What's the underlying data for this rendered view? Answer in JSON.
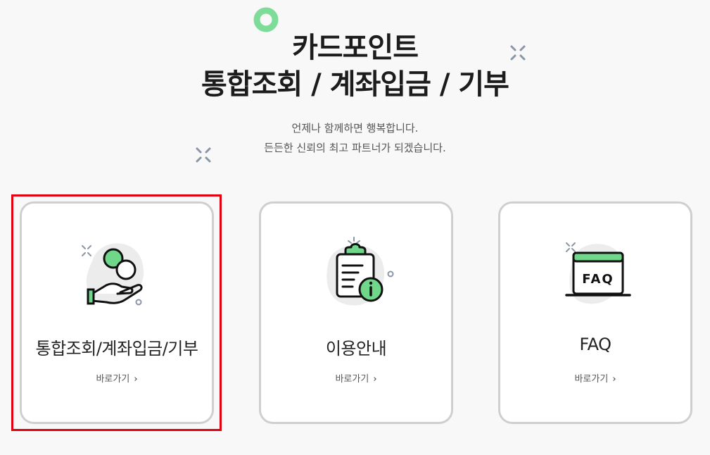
{
  "hero": {
    "title_line1": "카드포인트",
    "title_line2": "통합조회 / 계좌입금 / 기부",
    "subtitle_line1": "언제나 함께하면 행복합니다.",
    "subtitle_line2": "든든한 신뢰의 최고 파트너가 되겠습니다."
  },
  "cards": [
    {
      "title": "통합조회/계좌입금/기부",
      "link": "바로가기",
      "icon": "coins-hand-icon"
    },
    {
      "title": "이용안내",
      "link": "바로가기",
      "icon": "clipboard-info-icon"
    },
    {
      "title": "FAQ",
      "link": "바로가기",
      "icon": "faq-window-icon",
      "icon_text": "FAQ"
    }
  ],
  "colors": {
    "accent_green": "#6fd68a",
    "highlight_red": "#e3000f",
    "card_border": "#cfcfcf"
  }
}
